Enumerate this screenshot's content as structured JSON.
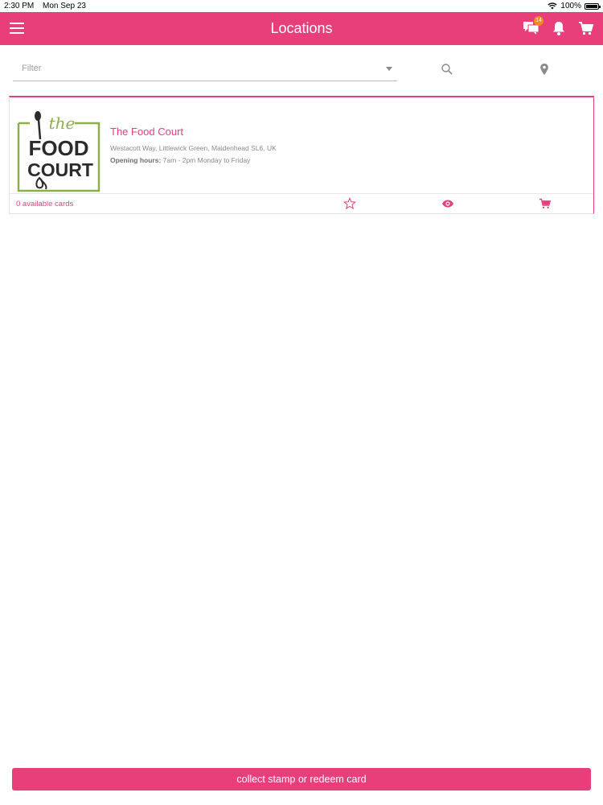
{
  "status_bar": {
    "time": "2:30 PM",
    "date": "Mon Sep 23",
    "battery": "100%"
  },
  "app_bar": {
    "title": "Locations",
    "messages_badge": "14",
    "icons": [
      "menu-icon",
      "chat-icon",
      "bell-icon",
      "cart-icon"
    ]
  },
  "filter": {
    "placeholder": "Filter",
    "icons": [
      "search-icon",
      "location-pin-icon"
    ]
  },
  "locations": [
    {
      "name": "The Food Court",
      "address": "Westacott Way, Littlewick Green, Maidenhead SL6, UK",
      "hours_label": "Opening hours:",
      "hours_value": " 7am - 2pm Monday to Friday",
      "available_cards": "0 available cards",
      "logo": {
        "line1": "the",
        "line2": "FOOD",
        "line3": "COURT"
      },
      "actions": [
        "star-icon",
        "eye-icon",
        "cart-icon"
      ]
    }
  ],
  "bottom_button": {
    "label": "collect stamp or redeem card"
  },
  "colors": {
    "accent": "#e83e7a",
    "logo_green": "#8bb04a",
    "logo_dark": "#2b2b2b",
    "badge": "#f68a1f"
  }
}
